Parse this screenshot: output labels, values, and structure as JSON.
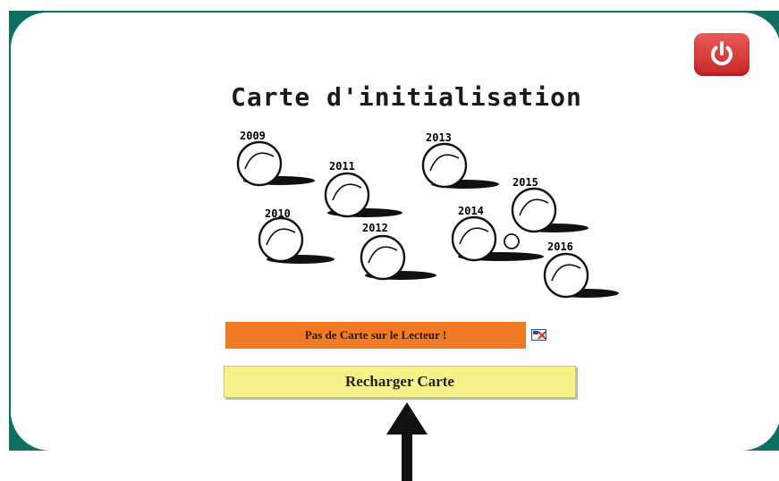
{
  "window": {
    "title": "Carte d'initialisation"
  },
  "toolbar": {
    "power_icon": "power-icon",
    "power_color": "#d7312f"
  },
  "illustration": {
    "labels": [
      "2009",
      "2011",
      "2013",
      "2015",
      "2010",
      "2012",
      "2014",
      "2016"
    ]
  },
  "status": {
    "message": "Pas de Carte sur le Lecteur !",
    "color": "#f07b24",
    "icon": "card-error-icon"
  },
  "actions": {
    "reload_label": "Recharger Carte",
    "reload_color": "#f6f18a"
  },
  "annotation": {
    "icon": "up-arrow-icon"
  }
}
